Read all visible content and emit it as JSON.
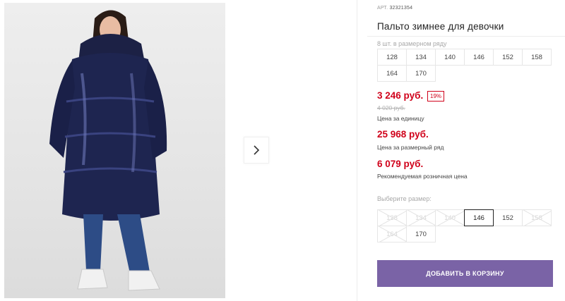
{
  "product": {
    "art_label": "АРТ.",
    "art_number": "32321354",
    "title": "Пальто зимнее для девочки"
  },
  "size_range": {
    "note": "8 шт. в размерном ряду",
    "sizes": [
      "128",
      "134",
      "140",
      "146",
      "152",
      "158",
      "164",
      "170"
    ]
  },
  "pricing": {
    "unit_price": "3 246 руб.",
    "discount": "19%",
    "old_price": "4 020 руб.",
    "unit_label": "Цена за единицу",
    "range_price": "25 968 руб.",
    "range_label": "Цена за размерный ряд",
    "retail_price": "6 079 руб.",
    "retail_label": "Рекомендуемая розничная цена"
  },
  "size_picker": {
    "label": "Выберите размер:",
    "options": [
      {
        "label": "128",
        "state": "disabled"
      },
      {
        "label": "134",
        "state": "disabled"
      },
      {
        "label": "140",
        "state": "disabled"
      },
      {
        "label": "146",
        "state": "selected"
      },
      {
        "label": "152",
        "state": "available"
      },
      {
        "label": "158",
        "state": "disabled"
      },
      {
        "label": "164",
        "state": "disabled"
      },
      {
        "label": "170",
        "state": "available"
      }
    ]
  },
  "cart_button": "ДОБАВИТЬ В КОРЗИНУ",
  "icons": {
    "next": "chevron-right-icon"
  },
  "colors": {
    "price_red": "#d0021b",
    "button_purple": "#7a63a6"
  }
}
